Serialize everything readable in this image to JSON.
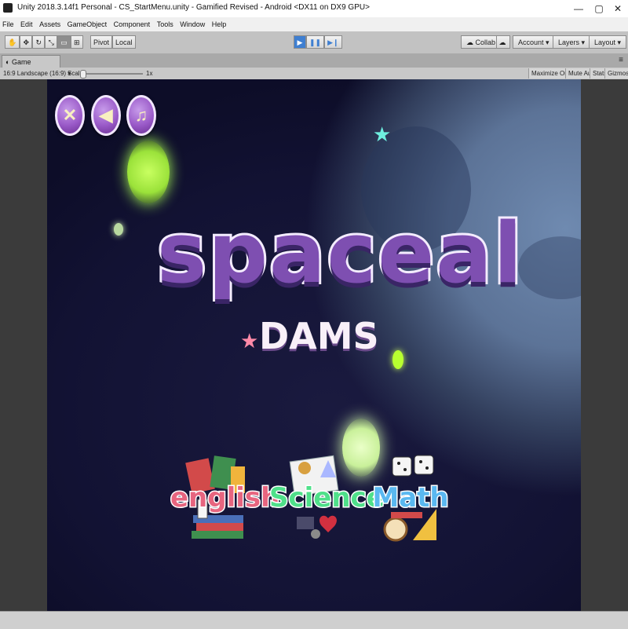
{
  "window": {
    "title": "Unity 2018.3.14f1 Personal - CS_StartMenu.unity - Gamified Revised - Android <DX11 on DX9 GPU>",
    "minimize": "—",
    "maximize": "▢",
    "close": "✕"
  },
  "menu": [
    "File",
    "Edit",
    "Assets",
    "GameObject",
    "Component",
    "Tools",
    "Window",
    "Help"
  ],
  "toolbar": {
    "pivot": "Pivot",
    "local": "Local",
    "collab": "Collab",
    "account": "Account",
    "layers": "Layers",
    "layout": "Layout"
  },
  "tab": {
    "label": "Game"
  },
  "gamebar": {
    "aspect": "16:9 Landscape (16:9)",
    "scale_label": "Scale",
    "scale_value": "1x",
    "maximize": "Maximize On Play",
    "mute": "Mute Audio",
    "stats": "Stats",
    "gizmos": "Gizmos"
  },
  "game": {
    "title": "spaceal",
    "subtitle": "DAMS",
    "subjects": [
      "english",
      "Science",
      "Math"
    ],
    "colors": {
      "title": "#7e4fb1",
      "english": "#e7657f",
      "science": "#4fe08a",
      "math": "#5ab8f0",
      "button": "#9a5ac8"
    }
  }
}
